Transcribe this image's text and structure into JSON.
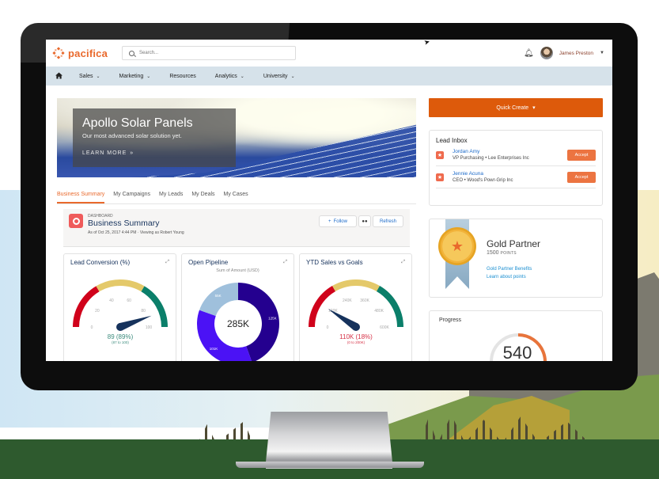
{
  "app": {
    "brand": "pacifica",
    "search_placeholder": "Search...",
    "user_name": "James Preston",
    "brand_color": "#e9692c"
  },
  "nav": {
    "items": [
      {
        "label": "Sales",
        "has_menu": true
      },
      {
        "label": "Marketing",
        "has_menu": true
      },
      {
        "label": "Resources",
        "has_menu": false
      },
      {
        "label": "Analytics",
        "has_menu": true
      },
      {
        "label": "University",
        "has_menu": true
      }
    ],
    "caret": "⌄"
  },
  "hero": {
    "title": "Apollo Solar Panels",
    "subtitle": "Our most advanced solar solution yet.",
    "cta": "LEARN MORE",
    "cta_icon": "»"
  },
  "tabs": [
    {
      "label": "Business Summary",
      "active": true
    },
    {
      "label": "My Campaigns",
      "active": false
    },
    {
      "label": "My Leads",
      "active": false
    },
    {
      "label": "My Deals",
      "active": false
    },
    {
      "label": "My Cases",
      "active": false
    }
  ],
  "dashboard": {
    "eyebrow": "DASHBOARD",
    "title": "Business Summary",
    "meta": "As of Oct 25, 2017 4:44 PM · Viewing as Robert Young",
    "follow_label": "Follow",
    "follow_icon": "+",
    "refresh_label": "Refresh"
  },
  "widgets": {
    "lead_conversion": {
      "title": "Lead Conversion (%)",
      "value_label": "89 (89%)",
      "range_label": "(87 to 100)",
      "color": "#3d8c7e"
    },
    "open_pipeline": {
      "title": "Open Pipeline",
      "subtitle": "Sum of Amount (USD)",
      "center_label": "285K"
    },
    "ytd_sales": {
      "title": "YTD Sales vs Goals",
      "value_label": "110K (18%)",
      "range_label": "(0 to 200K)",
      "color": "#d63247"
    }
  },
  "chart_data": [
    {
      "type": "gauge",
      "title": "Lead Conversion (%)",
      "min": 0,
      "max": 100,
      "ticks": [
        "0",
        "20",
        "40",
        "60",
        "80",
        "100"
      ],
      "bands": [
        {
          "from": 0,
          "to": 33,
          "color": "#d0021b"
        },
        {
          "from": 33,
          "to": 67,
          "color": "#e4c96a"
        },
        {
          "from": 67,
          "to": 100,
          "color": "#0b7f6a"
        }
      ],
      "value": 89
    },
    {
      "type": "pie",
      "title": "Open Pipeline",
      "subtitle": "Sum of Amount (USD)",
      "total_label": "285K",
      "slices": [
        {
          "label": "125K",
          "value": 125,
          "color": "#24008f"
        },
        {
          "label": "101K",
          "value": 101,
          "color": "#4b12f5"
        },
        {
          "label": "55K",
          "value": 55,
          "color": "#9fc0dc"
        }
      ]
    },
    {
      "type": "gauge",
      "title": "YTD Sales vs Goals",
      "min": 0,
      "max": 600,
      "ticks": [
        "0",
        "120K",
        "240K",
        "360K",
        "480K",
        "600K"
      ],
      "bands": [
        {
          "from": 0,
          "to": 200,
          "color": "#d0021b"
        },
        {
          "from": 200,
          "to": 400,
          "color": "#e4c96a"
        },
        {
          "from": 400,
          "to": 600,
          "color": "#0b7f6a"
        }
      ],
      "value": 110
    }
  ],
  "quick_create": {
    "label": "Quick Create",
    "caret": "▾",
    "color": "#dd5a0b"
  },
  "lead_inbox": {
    "title": "Lead Inbox",
    "accept_label": "Accept",
    "leads": [
      {
        "name": "Jordan Amy",
        "detail": "VP Purchasing  •  Lee Enterprises Inc"
      },
      {
        "name": "Jennie Acuna",
        "detail": "CEO  •  Wood's Powr-Grip Inc"
      }
    ]
  },
  "partner": {
    "title": "Gold Partner",
    "points": "1500",
    "points_label": "POINTS",
    "links": [
      "Gold Partner Benefits",
      "Learn about points"
    ]
  },
  "progress": {
    "title": "Progress",
    "value": "540",
    "fraction": 0.38,
    "color": "#e8743b"
  }
}
